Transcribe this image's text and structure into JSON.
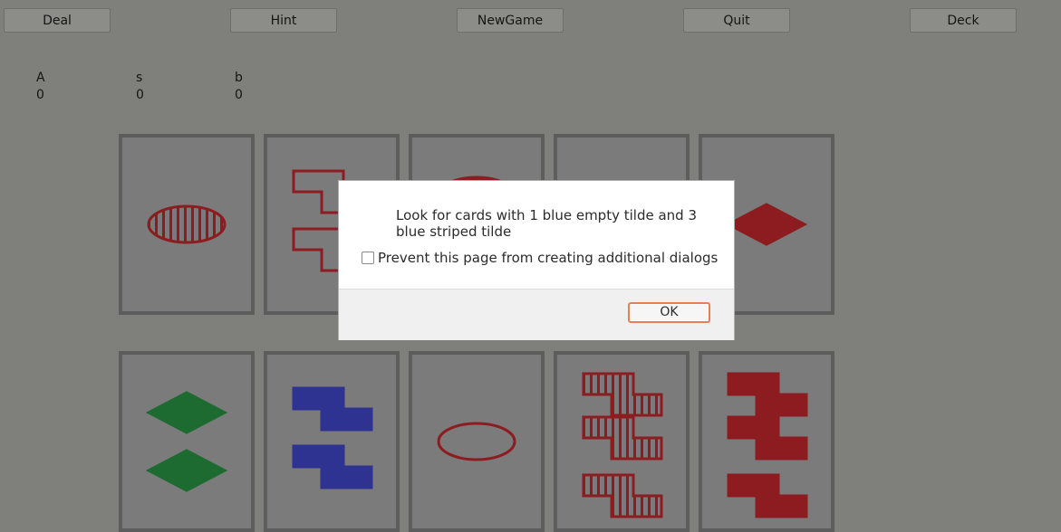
{
  "toolbar": {
    "deal_label": "Deal",
    "hint_label": "Hint",
    "newgame_label": "NewGame",
    "quit_label": "Quit",
    "deck_label": "Deck"
  },
  "scores": [
    {
      "label": "A",
      "value": "0"
    },
    {
      "label": "s",
      "value": "0"
    },
    {
      "label": "b",
      "value": "0"
    }
  ],
  "colors": {
    "red": "#8c1c20",
    "blue": "#2e3291",
    "green": "#1e6b31"
  },
  "cards": [
    {
      "row": 0,
      "col": 0,
      "count": 1,
      "color": "red",
      "shape": "oval",
      "fill": "striped"
    },
    {
      "row": 0,
      "col": 1,
      "count": 2,
      "color": "red",
      "shape": "tilde",
      "fill": "empty"
    },
    {
      "row": 0,
      "col": 2,
      "count": 2,
      "color": "red",
      "shape": "oval",
      "fill": "solid"
    },
    {
      "row": 0,
      "col": 3,
      "count": 0,
      "color": "red",
      "shape": "oval",
      "fill": "solid"
    },
    {
      "row": 0,
      "col": 4,
      "count": 1,
      "color": "red",
      "shape": "diamond",
      "fill": "solid"
    },
    {
      "row": 1,
      "col": 0,
      "count": 2,
      "color": "green",
      "shape": "diamond",
      "fill": "solid"
    },
    {
      "row": 1,
      "col": 1,
      "count": 2,
      "color": "blue",
      "shape": "tilde",
      "fill": "solid"
    },
    {
      "row": 1,
      "col": 2,
      "count": 1,
      "color": "red",
      "shape": "oval",
      "fill": "empty"
    },
    {
      "row": 1,
      "col": 3,
      "count": 3,
      "color": "red",
      "shape": "tilde",
      "fill": "striped"
    },
    {
      "row": 1,
      "col": 4,
      "count": 3,
      "color": "red",
      "shape": "tilde",
      "fill": "solid"
    }
  ],
  "dialog": {
    "message": "Look for cards with 1 blue empty tilde and 3 blue striped tilde",
    "prevent_label": "Prevent this page from creating additional dialogs",
    "ok_label": "OK"
  }
}
